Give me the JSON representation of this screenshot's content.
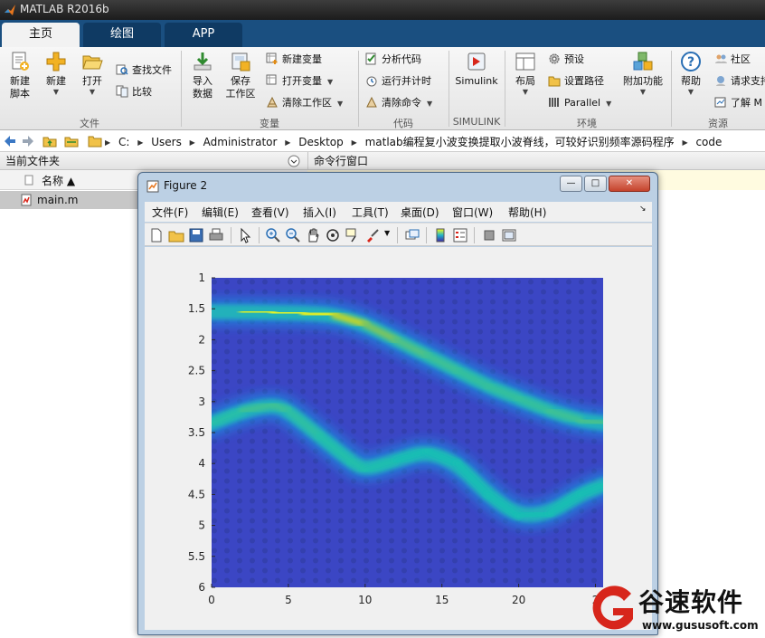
{
  "app": {
    "title": "MATLAB R2016b"
  },
  "tabs": [
    {
      "label": "主页"
    },
    {
      "label": "绘图"
    },
    {
      "label": "APP"
    }
  ],
  "ribbon": {
    "file": {
      "label": "文件",
      "new_script": "新建\n脚本",
      "new": "新建",
      "open": "打开",
      "find_files": "查找文件",
      "compare": "比较"
    },
    "variable": {
      "label": "变量",
      "import": "导入\n数据",
      "save_ws": "保存\n工作区",
      "new_var": "新建变量",
      "open_var": "打开变量",
      "clear_ws": "清除工作区"
    },
    "code": {
      "label": "代码",
      "analyze": "分析代码",
      "run_time": "运行并计时",
      "clear_cmd": "清除命令"
    },
    "simulink": {
      "label": "SIMULINK",
      "btn": "Simulink"
    },
    "env": {
      "label": "环境",
      "layout": "布局",
      "prefs": "预设",
      "set_path": "设置路径",
      "parallel": "Parallel",
      "addons": "附加功能"
    },
    "resources": {
      "label": "资源",
      "help": "帮助",
      "community": "社区",
      "request": "请求支持",
      "learn": "了解 M"
    }
  },
  "address": {
    "crumbs": [
      "C:",
      "Users",
      "Administrator",
      "Desktop",
      "matlab编程复小波变换提取小波脊线，可较好识别频率源码程序",
      "code"
    ]
  },
  "panels": {
    "current_folder": "当前文件夹",
    "name_col": "名称 ▲",
    "file": "main.m",
    "command_window": "命令行窗口"
  },
  "figure": {
    "title": "Figure 2",
    "menus": [
      "文件(F)",
      "编辑(E)",
      "查看(V)",
      "插入(I)",
      "工具(T)",
      "桌面(D)",
      "窗口(W)",
      "帮助(H)"
    ]
  },
  "chart_data": {
    "type": "heatmap",
    "title": "",
    "xlabel": "",
    "ylabel": "",
    "x_ticks": [
      0,
      5,
      10,
      15,
      20,
      25
    ],
    "x_tick_labels": [
      "0",
      "5",
      "10",
      "15",
      "20",
      "2"
    ],
    "y_ticks": [
      1,
      1.5,
      2,
      2.5,
      3,
      3.5,
      4,
      4.5,
      5,
      5.5,
      6
    ],
    "y_tick_labels": [
      "1",
      "1.5",
      "2",
      "2.5",
      "3",
      "3.5",
      "4",
      "4.5",
      "5",
      "5.5",
      "6"
    ],
    "xlim": [
      0,
      25.5
    ],
    "ylim": [
      1,
      6
    ],
    "y_reversed": true,
    "colormap": "parula",
    "series": [
      {
        "x": [
          0,
          2,
          4,
          6,
          8,
          10,
          12,
          14,
          16,
          18,
          20,
          22,
          24,
          25.5
        ],
        "y": [
          1.55,
          1.55,
          1.56,
          1.57,
          1.6,
          1.75,
          2.0,
          2.25,
          2.5,
          2.75,
          2.95,
          3.15,
          3.3,
          3.35
        ],
        "peak_intensity": [
          0.85,
          0.95,
          1.0,
          1.0,
          0.9,
          0.72,
          0.62,
          0.58,
          0.55,
          0.55,
          0.55,
          0.55,
          0.58,
          0.58
        ]
      },
      {
        "x": [
          0,
          2,
          4,
          5,
          7,
          9,
          10,
          12,
          14,
          16,
          18,
          20,
          22,
          24,
          25.5
        ],
        "y": [
          3.35,
          3.15,
          3.05,
          3.15,
          3.55,
          3.95,
          4.1,
          3.95,
          3.8,
          4.0,
          4.5,
          4.85,
          4.8,
          4.5,
          4.35
        ],
        "peak_intensity": [
          0.5,
          0.55,
          0.58,
          0.55,
          0.52,
          0.52,
          0.52,
          0.5,
          0.5,
          0.5,
          0.5,
          0.5,
          0.5,
          0.5,
          0.5
        ]
      }
    ]
  },
  "watermark": {
    "text": "谷速软件",
    "url": "www.gususoft.com",
    "brand_color": "#d7261b"
  }
}
